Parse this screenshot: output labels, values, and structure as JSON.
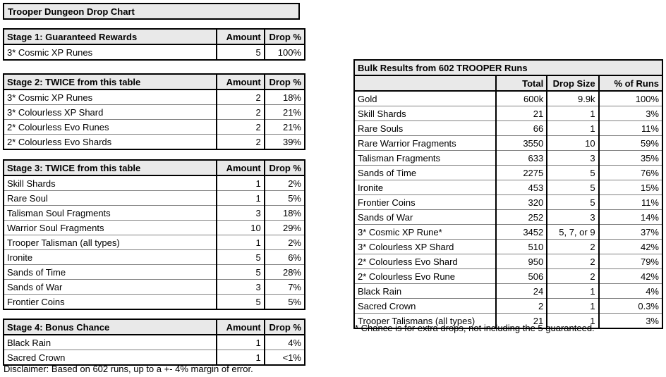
{
  "title_banner": {
    "text": "Trooper Dungeon Drop Chart"
  },
  "left_tables": [
    {
      "id": "stage1",
      "header": {
        "name": "Stage 1: Guaranteed Rewards",
        "amount": "Amount",
        "drop": "Drop %"
      },
      "rows": [
        {
          "name": "3* Cosmic XP Runes",
          "amount": "5",
          "drop": "100%"
        }
      ]
    },
    {
      "id": "stage2",
      "header": {
        "name": "Stage 2: TWICE from this table",
        "amount": "Amount",
        "drop": "Drop %"
      },
      "rows": [
        {
          "name": "3* Cosmic XP Runes",
          "amount": "2",
          "drop": "18%"
        },
        {
          "name": "3* Colourless XP Shard",
          "amount": "2",
          "drop": "21%"
        },
        {
          "name": "2* Colourless Evo Runes",
          "amount": "2",
          "drop": "21%"
        },
        {
          "name": "2* Colourless Evo Shards",
          "amount": "2",
          "drop": "39%"
        }
      ]
    },
    {
      "id": "stage3",
      "header": {
        "name": "Stage 3: TWICE from this table",
        "amount": "Amount",
        "drop": "Drop %"
      },
      "rows": [
        {
          "name": "Skill Shards",
          "amount": "1",
          "drop": "2%"
        },
        {
          "name": "Rare Soul",
          "amount": "1",
          "drop": "5%"
        },
        {
          "name": "Talisman Soul Fragments",
          "amount": "3",
          "drop": "18%"
        },
        {
          "name": "Warrior Soul Fragments",
          "amount": "10",
          "drop": "29%"
        },
        {
          "name": "Trooper Talisman (all types)",
          "amount": "1",
          "drop": "2%"
        },
        {
          "name": "Ironite",
          "amount": "5",
          "drop": "6%"
        },
        {
          "name": "Sands of Time",
          "amount": "5",
          "drop": "28%"
        },
        {
          "name": "Sands of War",
          "amount": "3",
          "drop": "7%"
        },
        {
          "name": "Frontier Coins",
          "amount": "5",
          "drop": "5%"
        }
      ]
    },
    {
      "id": "stage4",
      "header": {
        "name": "Stage 4: Bonus Chance",
        "amount": "Amount",
        "drop": "Drop %"
      },
      "rows": [
        {
          "name": "Black Rain",
          "amount": "1",
          "drop": "4%"
        },
        {
          "name": "Sacred Crown",
          "amount": "1",
          "drop": "<1%"
        }
      ]
    }
  ],
  "disclaimer": {
    "text": "Disclaimer: Based on 602 runs, up to a +- 4% margin of error."
  },
  "bulk_table": {
    "title": "Bulk Results from 602 TROOPER Runs",
    "columns": {
      "name": "",
      "total": "Total",
      "drop_size": "Drop Size",
      "pct_of_runs": "% of Runs"
    },
    "rows": [
      {
        "name": "Gold",
        "total": "600k",
        "drop_size": "9.9k",
        "pct": "100%"
      },
      {
        "name": "Skill Shards",
        "total": "21",
        "drop_size": "1",
        "pct": "3%"
      },
      {
        "name": "Rare Souls",
        "total": "66",
        "drop_size": "1",
        "pct": "11%"
      },
      {
        "name": "Rare Warrior Fragments",
        "total": "3550",
        "drop_size": "10",
        "pct": "59%"
      },
      {
        "name": "Talisman Fragments",
        "total": "633",
        "drop_size": "3",
        "pct": "35%"
      },
      {
        "name": "Sands of Time",
        "total": "2275",
        "drop_size": "5",
        "pct": "76%"
      },
      {
        "name": "Ironite",
        "total": "453",
        "drop_size": "5",
        "pct": "15%"
      },
      {
        "name": "Frontier Coins",
        "total": "320",
        "drop_size": "5",
        "pct": "11%"
      },
      {
        "name": "Sands of War",
        "total": "252",
        "drop_size": "3",
        "pct": "14%"
      },
      {
        "name": "3* Cosmic XP Rune*",
        "total": "3452",
        "drop_size": "5, 7, or 9",
        "pct": "37%"
      },
      {
        "name": "3* Colourless XP Shard",
        "total": "510",
        "drop_size": "2",
        "pct": "42%"
      },
      {
        "name": "2* Colourless Evo Shard",
        "total": "950",
        "drop_size": "2",
        "pct": "79%"
      },
      {
        "name": "2* Colourless Evo Rune",
        "total": "506",
        "drop_size": "2",
        "pct": "42%"
      },
      {
        "name": "Black Rain",
        "total": "24",
        "drop_size": "1",
        "pct": "4%"
      },
      {
        "name": "Sacred Crown",
        "total": "2",
        "drop_size": "1",
        "pct": "0.3%"
      },
      {
        "name": "Trooper Talismans (all types)",
        "total": "21",
        "drop_size": "1",
        "pct": "3%"
      }
    ],
    "footnote": "* Chance is for extra drops, not including the 5 guaranteed."
  },
  "colors": {
    "header_fill": "#e9e9e9",
    "border_heavy": "#000000",
    "border_light": "#808080",
    "page_background": "#ffffff"
  }
}
